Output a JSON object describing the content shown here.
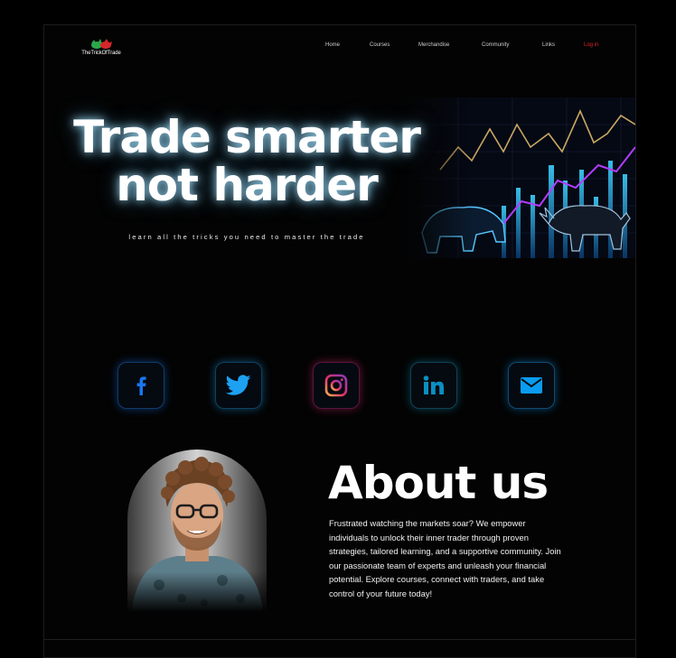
{
  "brand": {
    "logo_text": "TheTrickOfTrade"
  },
  "nav": {
    "items": [
      "Home",
      "Courses",
      "Merchandise",
      "Community",
      "Links"
    ],
    "login": "Log in"
  },
  "hero": {
    "title_line1": "Trade smarter",
    "title_line2": "not harder",
    "subtitle": "learn all the tricks you need to master the trade"
  },
  "social": [
    {
      "name": "facebook-icon",
      "color": "#1877f2"
    },
    {
      "name": "twitter-icon",
      "color": "#1da1f2"
    },
    {
      "name": "instagram-icon",
      "color": "#e1306c"
    },
    {
      "name": "linkedin-icon",
      "color": "#0a66c2"
    },
    {
      "name": "mail-icon",
      "color": "#0a9cf0"
    }
  ],
  "about": {
    "title": "About us",
    "body": "Frustrated watching the markets soar? We empower individuals to unlock their inner trader through proven strategies, tailored learning, and a supportive community. Join our passionate team of experts and unleash your financial potential. Explore courses, connect with traders, and take control of your future today!"
  },
  "colors": {
    "accent_login": "#e0262a",
    "background": "#000000"
  }
}
